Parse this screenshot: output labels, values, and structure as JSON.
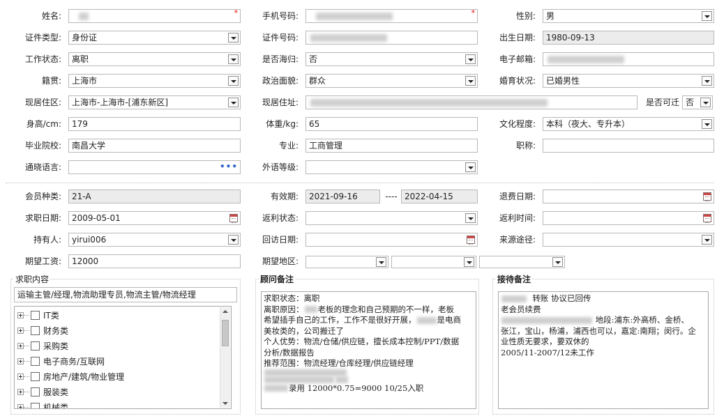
{
  "personal": {
    "name_label": "姓名:",
    "name_required": "*",
    "phone_label": "手机号码:",
    "phone_required": "*",
    "gender_label": "性别:",
    "gender_value": "男",
    "id_type_label": "证件类型:",
    "id_type_value": "身份证",
    "id_number_label": "证件号码:",
    "birth_label": "出生日期:",
    "birth_value": "1980-09-13",
    "work_status_label": "工作状态:",
    "work_status_value": "离职",
    "returnee_label": "是否海归:",
    "returnee_value": "否",
    "email_label": "电子邮箱:",
    "native_label": "籍贯:",
    "native_value": "上海市",
    "political_label": "政治面貌:",
    "political_value": "群众",
    "marital_label": "婚育状况:",
    "marital_value": "已婚男性",
    "residence_area_label": "现居住区:",
    "residence_area_value": "上海市-上海市-[浦东新区]",
    "residence_addr_label": "现居住址:",
    "relocate_label": "是否可迁",
    "relocate_value": "否",
    "height_label": "身高/cm:",
    "height_value": "179",
    "weight_label": "体重/kg:",
    "weight_value": "65",
    "education_label": "文化程度:",
    "education_value": "本科（夜大、专升本）",
    "school_label": "毕业院校:",
    "school_value": "南昌大学",
    "major_label": "专业:",
    "major_value": "工商管理",
    "title_label": "职称:",
    "language_label": "通晓语言:",
    "language_more": "•••",
    "foreign_level_label": "外语等级:"
  },
  "membership": {
    "type_label": "会员种类:",
    "type_value": "21-A",
    "valid_label": "有效期:",
    "valid_from": "2021-09-16",
    "valid_sep": "----",
    "valid_to": "2022-04-15",
    "refund_date_label": "退费日期:",
    "job_date_label": "求职日期:",
    "job_date_value": "2009-05-01",
    "rebate_status_label": "返利状态:",
    "rebate_time_label": "返利时间:",
    "holder_label": "持有人:",
    "holder_value": "yirui006",
    "revisit_label": "回访日期:",
    "source_label": "来源途径:",
    "salary_label": "期望工资:",
    "salary_value": "12000",
    "region_label": "期望地区:"
  },
  "job_panel": {
    "title": "求职内容",
    "summary": "运输主管/经理,物流助理专员,物流主管/物流经理",
    "categories": [
      "IT类",
      "财务类",
      "采购类",
      "电子商务/互联网",
      "房地产/建筑/物业管理",
      "服装类",
      "机械类"
    ]
  },
  "consultant_panel": {
    "title": "顾问备注",
    "lines": [
      {
        "pre": "",
        "post": "求职状态：离职"
      },
      {
        "pre": "离职原因：",
        "post": "老板的理念和自己预期的不一样，老板"
      },
      {
        "pre": "希望插手自己的工作，工作不是很好开展，",
        "post": "是电商"
      },
      {
        "pre": "",
        "post": "美妆类的，公司搬迁了"
      },
      {
        "pre": "",
        "post": "个人优势：物流/仓储/供应链，擅长成本控制/PPT/数据"
      },
      {
        "pre": "",
        "post": "分析/数据报告"
      },
      {
        "pre": "",
        "post": "推荐范围：物流经理/仓库经理/供应链经理"
      },
      {
        "pre": "",
        "post": ""
      },
      {
        "pre": "",
        "post": ""
      },
      {
        "pre": "",
        "post": "录用  12000*0.75=9000  10/25入职"
      }
    ]
  },
  "reception_panel": {
    "title": "接待备注",
    "line1": "转账 协议已回传",
    "line2": "老会员续费",
    "line3": "地段:浦东:外高桥、金桥、",
    "line4": "张江，宝山，杨浦，浦西也可以，嘉定:南翔；闵行。企",
    "line5": "业性质无要求，要双休的",
    "line6": "2005/11-2007/12未工作"
  }
}
